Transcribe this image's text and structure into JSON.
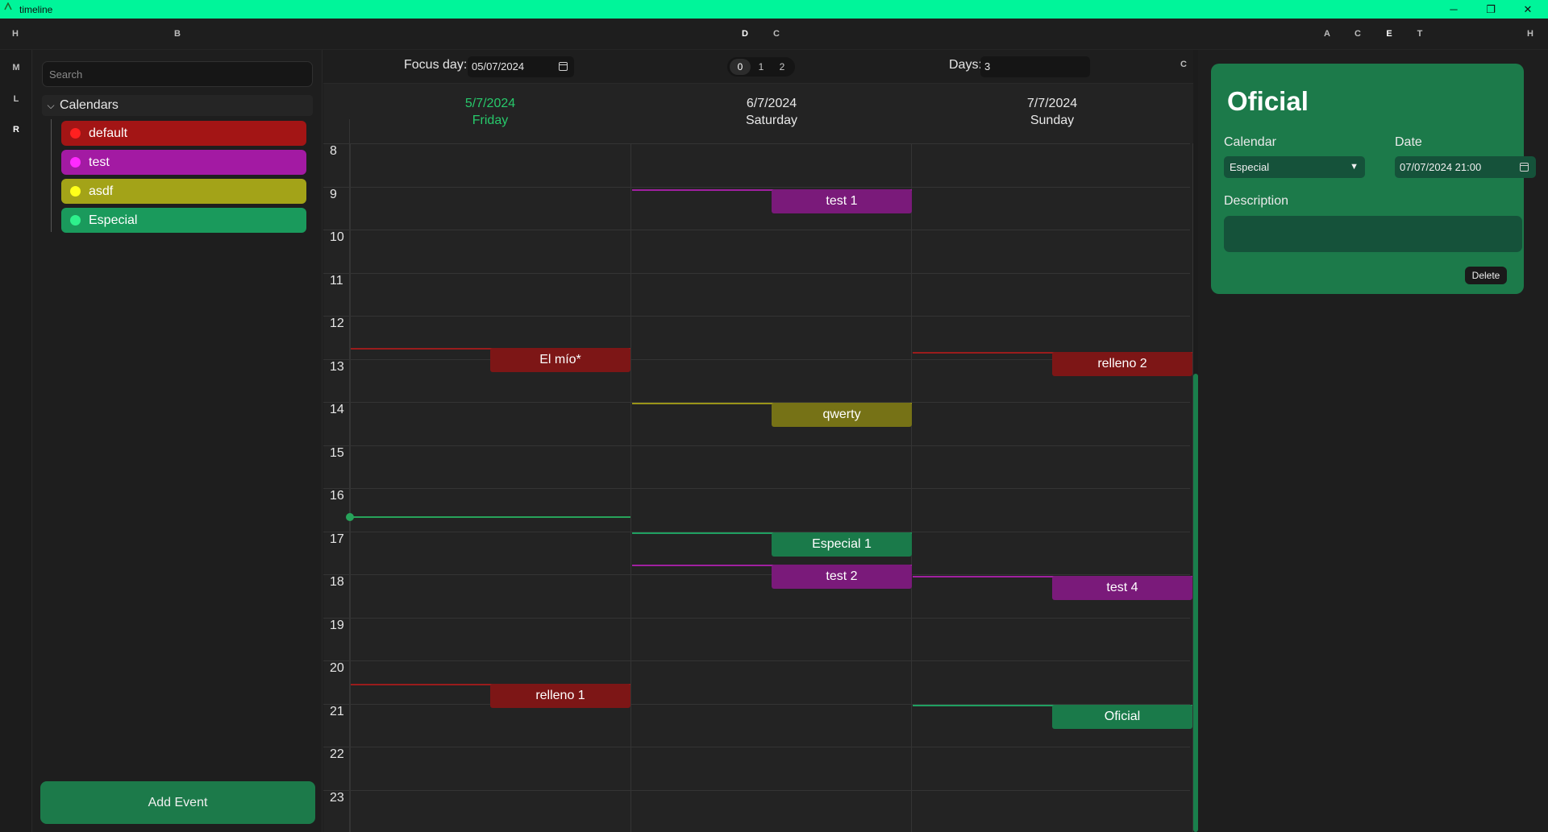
{
  "window": {
    "title": "timeline",
    "accent": "#00f59a",
    "controls": {
      "minimize": "─",
      "maximize": "❐",
      "close": "✕"
    }
  },
  "toolbar": {
    "left": "H",
    "b": "B",
    "center": [
      "D",
      "C"
    ],
    "right": [
      "A",
      "C",
      "E",
      "T"
    ],
    "far_right": "H"
  },
  "rail": [
    "M",
    "L",
    "R"
  ],
  "sidebar": {
    "search_placeholder": "Search",
    "calendars_label": "Calendars",
    "calendars": [
      {
        "name": "default",
        "color": "#a31515",
        "dot": "#ff2020"
      },
      {
        "name": "test",
        "color": "#a31aa3",
        "dot": "#ff2aff"
      },
      {
        "name": "asdf",
        "color": "#a3a318",
        "dot": "#ffff1a"
      },
      {
        "name": "Especial",
        "color": "#1a9a5c",
        "dot": "#2ef08c"
      }
    ],
    "add_event": "Add Event"
  },
  "calendar": {
    "focus_label": "Focus day:",
    "focus_value": "05/07/2024",
    "segments": [
      "0",
      "1",
      "2"
    ],
    "active_segment": 0,
    "days_label": "Days:",
    "days_value": "3",
    "right_btn": "C",
    "days": [
      {
        "date": "5/7/2024",
        "weekday": "Friday",
        "today": true
      },
      {
        "date": "6/7/2024",
        "weekday": "Saturday",
        "today": false
      },
      {
        "date": "7/7/2024",
        "weekday": "Sunday",
        "today": false
      }
    ],
    "hours": [
      "8",
      "9",
      "10",
      "11",
      "12",
      "13",
      "14",
      "15",
      "16",
      "17",
      "18",
      "19",
      "20",
      "21",
      "22",
      "23"
    ],
    "now": {
      "day": 0,
      "time": 16.65
    },
    "events": [
      {
        "title": "test 1",
        "day": 1,
        "start": 9.07,
        "color": "#7a1a7a",
        "line": "#a020a0"
      },
      {
        "title": "El mío*",
        "day": 0,
        "start": 12.75,
        "color": "#7d1616",
        "line": "#9a1c1c"
      },
      {
        "title": "relleno 2",
        "day": 2,
        "start": 12.85,
        "color": "#7d1616",
        "line": "#9a1c1c"
      },
      {
        "title": "qwerty",
        "day": 1,
        "start": 14.02,
        "color": "#767216",
        "line": "#9a9418"
      },
      {
        "title": "Especial 1",
        "day": 1,
        "start": 17.03,
        "color": "#1a7a4a",
        "line": "#1fa061"
      },
      {
        "title": "test 2",
        "day": 1,
        "start": 17.78,
        "color": "#7a1a7a",
        "line": "#a020a0"
      },
      {
        "title": "test 4",
        "day": 2,
        "start": 18.03,
        "color": "#7a1a7a",
        "line": "#a020a0"
      },
      {
        "title": "relleno 1",
        "day": 0,
        "start": 20.55,
        "color": "#7d1616",
        "line": "#9a1c1c"
      },
      {
        "title": "Oficial",
        "day": 2,
        "start": 21.03,
        "color": "#1a7a4a",
        "line": "#1fa061"
      }
    ]
  },
  "detail": {
    "title": "Oficial",
    "calendar_label": "Calendar",
    "calendar_value": "Especial",
    "date_label": "Date",
    "date_value": "07/07/2024 21:00",
    "description_label": "Description",
    "description_value": "",
    "delete": "Delete"
  }
}
